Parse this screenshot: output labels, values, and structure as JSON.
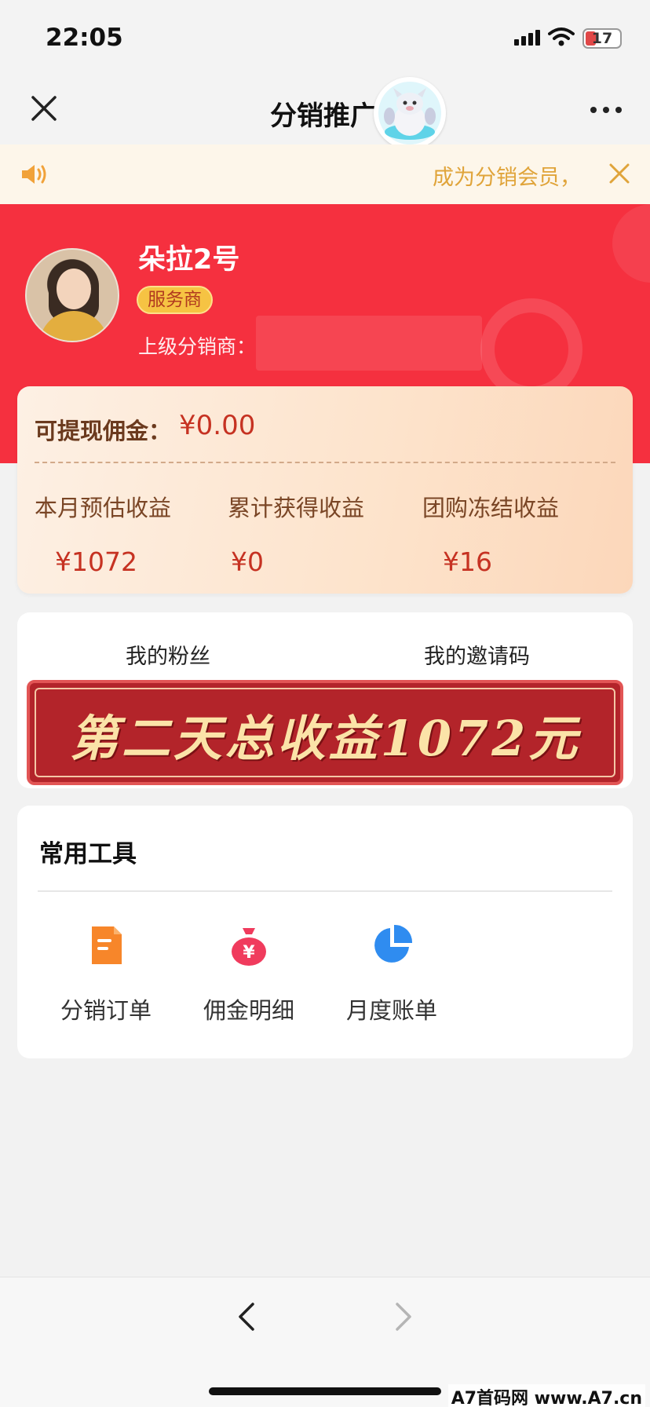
{
  "status_bar": {
    "time": "22:05",
    "battery": "17"
  },
  "nav": {
    "title": "分销推广"
  },
  "notice": {
    "text": "成为分销会员，"
  },
  "profile": {
    "name": "朵拉2号",
    "role": "服务商",
    "superior_label": "上级分销商："
  },
  "earnings": {
    "withdrawable_label": "可提现佣金：",
    "withdrawable_value": "¥0.00",
    "items": [
      {
        "label": "本月预估收益",
        "value": "¥1072"
      },
      {
        "label": "累计获得收益",
        "value": "¥0"
      },
      {
        "label": "团购冻结收益",
        "value": "¥16"
      }
    ]
  },
  "tabs": {
    "fans": "我的粉丝",
    "invite": "我的邀请码"
  },
  "promo": {
    "text": "第二天总收益1072元"
  },
  "tools": {
    "title": "常用工具",
    "items": [
      {
        "label": "分销订单",
        "icon": "document-icon",
        "color": "#f7862a"
      },
      {
        "label": "佣金明细",
        "icon": "money-bag-icon",
        "color": "#f03b5d"
      },
      {
        "label": "月度账单",
        "icon": "pie-chart-icon",
        "color": "#2f8cf0"
      }
    ]
  },
  "watermark": {
    "text": "A7首码网 www.A7.cn"
  },
  "colors": {
    "header_red": "#f5303f",
    "accent_gold": "#e0a43a",
    "money_red": "#c63222"
  }
}
